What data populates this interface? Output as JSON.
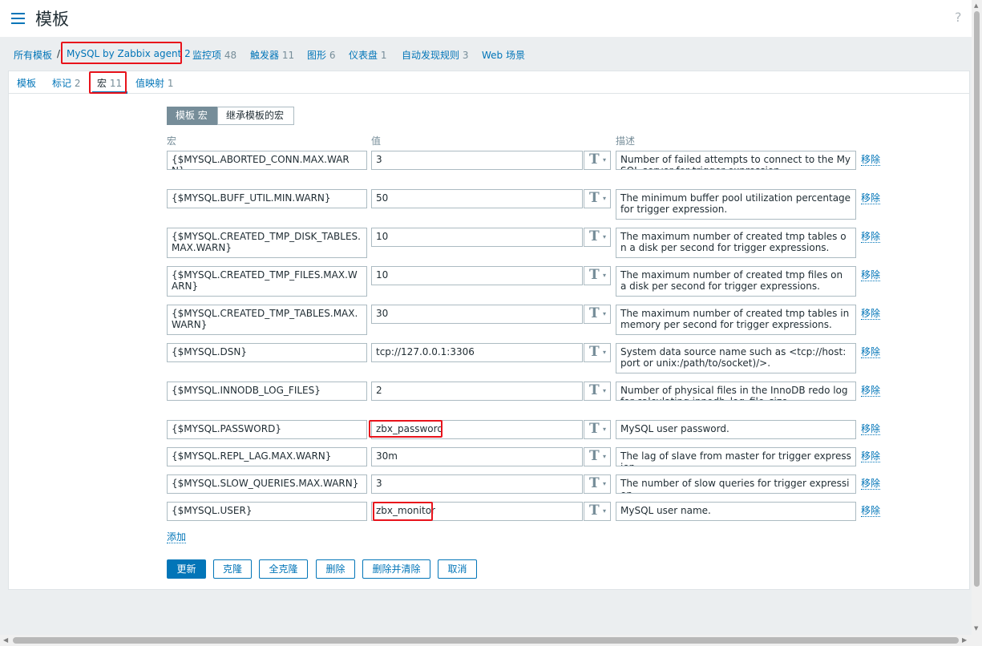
{
  "header": {
    "title": "模板",
    "help": "?"
  },
  "breadcrumb": {
    "all_templates": "所有模板",
    "sep": "/",
    "template_name": "MySQL by Zabbix agent 2",
    "items": [
      {
        "label": "监控项",
        "count": "48"
      },
      {
        "label": "触发器",
        "count": "11"
      },
      {
        "label": "图形",
        "count": "6"
      },
      {
        "label": "仪表盘",
        "count": "1"
      },
      {
        "label": "自动发现规则",
        "count": "3"
      },
      {
        "label": "Web 场景",
        "count": ""
      }
    ]
  },
  "tabs": [
    {
      "label": "模板",
      "count": ""
    },
    {
      "label": "标记",
      "count": "2"
    },
    {
      "label": "宏",
      "count": "11"
    },
    {
      "label": "值映射",
      "count": "1"
    }
  ],
  "macro_toggle": {
    "template": "模板 宏",
    "inherited": "继承模板的宏"
  },
  "columns": {
    "macro": "宏",
    "value": "值",
    "description": "描述"
  },
  "macros": [
    {
      "macro": "{$MYSQL.ABORTED_CONN.MAX.WARN}",
      "value": "3",
      "type": "T",
      "description": "Number of failed attempts to connect to the MySQL server for trigger expression."
    },
    {
      "macro": "{$MYSQL.BUFF_UTIL.MIN.WARN}",
      "value": "50",
      "type": "T",
      "description": "The minimum buffer pool utilization percentage for trigger expression."
    },
    {
      "macro": "{$MYSQL.CREATED_TMP_DISK_TABLES.MAX.WARN}",
      "value": "10",
      "type": "T",
      "description": "The maximum number of created tmp tables on a disk per second for trigger expressions."
    },
    {
      "macro": "{$MYSQL.CREATED_TMP_FILES.MAX.WARN}",
      "value": "10",
      "type": "T",
      "description": "The maximum number of created tmp files on a disk per second for trigger expressions."
    },
    {
      "macro": "{$MYSQL.CREATED_TMP_TABLES.MAX.WARN}",
      "value": "30",
      "type": "T",
      "description": "The maximum number of created tmp tables in memory per second for trigger expressions."
    },
    {
      "macro": "{$MYSQL.DSN}",
      "value": "tcp://127.0.0.1:3306",
      "type": "T",
      "description": "System data source name such as <tcp://host:port or unix:/path/to/socket)/>."
    },
    {
      "macro": "{$MYSQL.INNODB_LOG_FILES}",
      "value": "2",
      "type": "T",
      "description": "Number of physical files in the InnoDB redo log for calculating innodb_log_file_size."
    },
    {
      "macro": "{$MYSQL.PASSWORD}",
      "value": "zbx_password",
      "type": "T",
      "description": "MySQL user password."
    },
    {
      "macro": "{$MYSQL.REPL_LAG.MAX.WARN}",
      "value": "30m",
      "type": "T",
      "description": "The lag of slave from master for trigger expression."
    },
    {
      "macro": "{$MYSQL.SLOW_QUERIES.MAX.WARN}",
      "value": "3",
      "type": "T",
      "description": "The number of slow queries for trigger expression."
    },
    {
      "macro": "{$MYSQL.USER}",
      "value": "zbx_monitor",
      "type": "T",
      "description": "MySQL user name."
    }
  ],
  "remove_label": "移除",
  "add_label": "添加",
  "buttons": {
    "update": "更新",
    "clone": "克隆",
    "full_clone": "全克隆",
    "delete": "删除",
    "delete_clear": "删除并清除",
    "cancel": "取消"
  },
  "colors": {
    "link": "#0275b8",
    "highlight": "#e8131b",
    "muted": "#768d99"
  }
}
